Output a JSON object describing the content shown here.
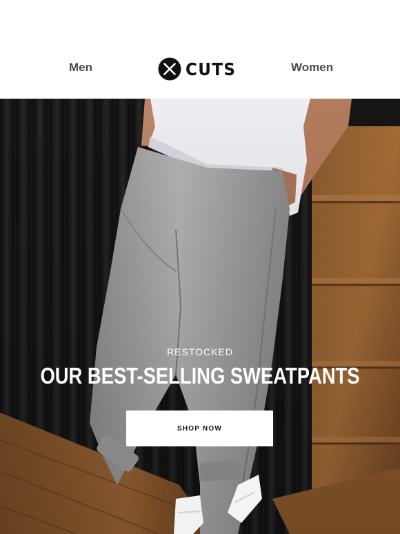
{
  "header": {
    "nav_left": "Men",
    "brand": "CUTS",
    "nav_right": "Women"
  },
  "hero": {
    "eyebrow": "RESTOCKED",
    "title": "OUR BEST-SELLING SWEATPANTS",
    "cta_label": "SHOP NOW"
  },
  "colors": {
    "nav_text": "#4a4a4a",
    "brand_black": "#111111",
    "hero_text": "#ffffff",
    "button_bg": "#ffffff"
  }
}
